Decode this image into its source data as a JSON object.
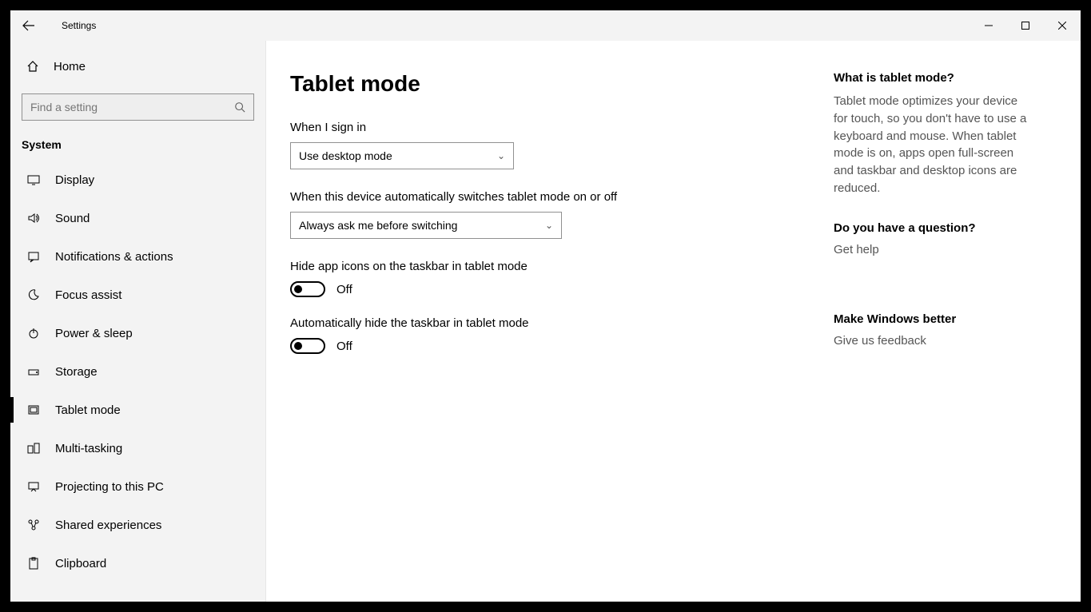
{
  "titlebar": {
    "title": "Settings"
  },
  "sidebar": {
    "home": "Home",
    "search_placeholder": "Find a setting",
    "section": "System",
    "items": [
      {
        "label": "Display"
      },
      {
        "label": "Sound"
      },
      {
        "label": "Notifications & actions"
      },
      {
        "label": "Focus assist"
      },
      {
        "label": "Power & sleep"
      },
      {
        "label": "Storage"
      },
      {
        "label": "Tablet mode"
      },
      {
        "label": "Multi-tasking"
      },
      {
        "label": "Projecting to this PC"
      },
      {
        "label": "Shared experiences"
      },
      {
        "label": "Clipboard"
      }
    ]
  },
  "main": {
    "title": "Tablet mode",
    "signin_label": "When I sign in",
    "signin_value": "Use desktop mode",
    "switch_label": "When this device automatically switches tablet mode on or off",
    "switch_value": "Always ask me before switching",
    "hide_icons_label": "Hide app icons on the taskbar in tablet mode",
    "hide_icons_state": "Off",
    "hide_taskbar_label": "Automatically hide the taskbar in tablet mode",
    "hide_taskbar_state": "Off"
  },
  "panel": {
    "what_heading": "What is tablet mode?",
    "what_text": "Tablet mode optimizes your device for touch, so you don't have to use a keyboard and mouse. When tablet mode is on, apps open full-screen and taskbar and desktop icons are reduced.",
    "question_heading": "Do you have a question?",
    "help_link": "Get help",
    "better_heading": "Make Windows better",
    "feedback_link": "Give us feedback"
  }
}
